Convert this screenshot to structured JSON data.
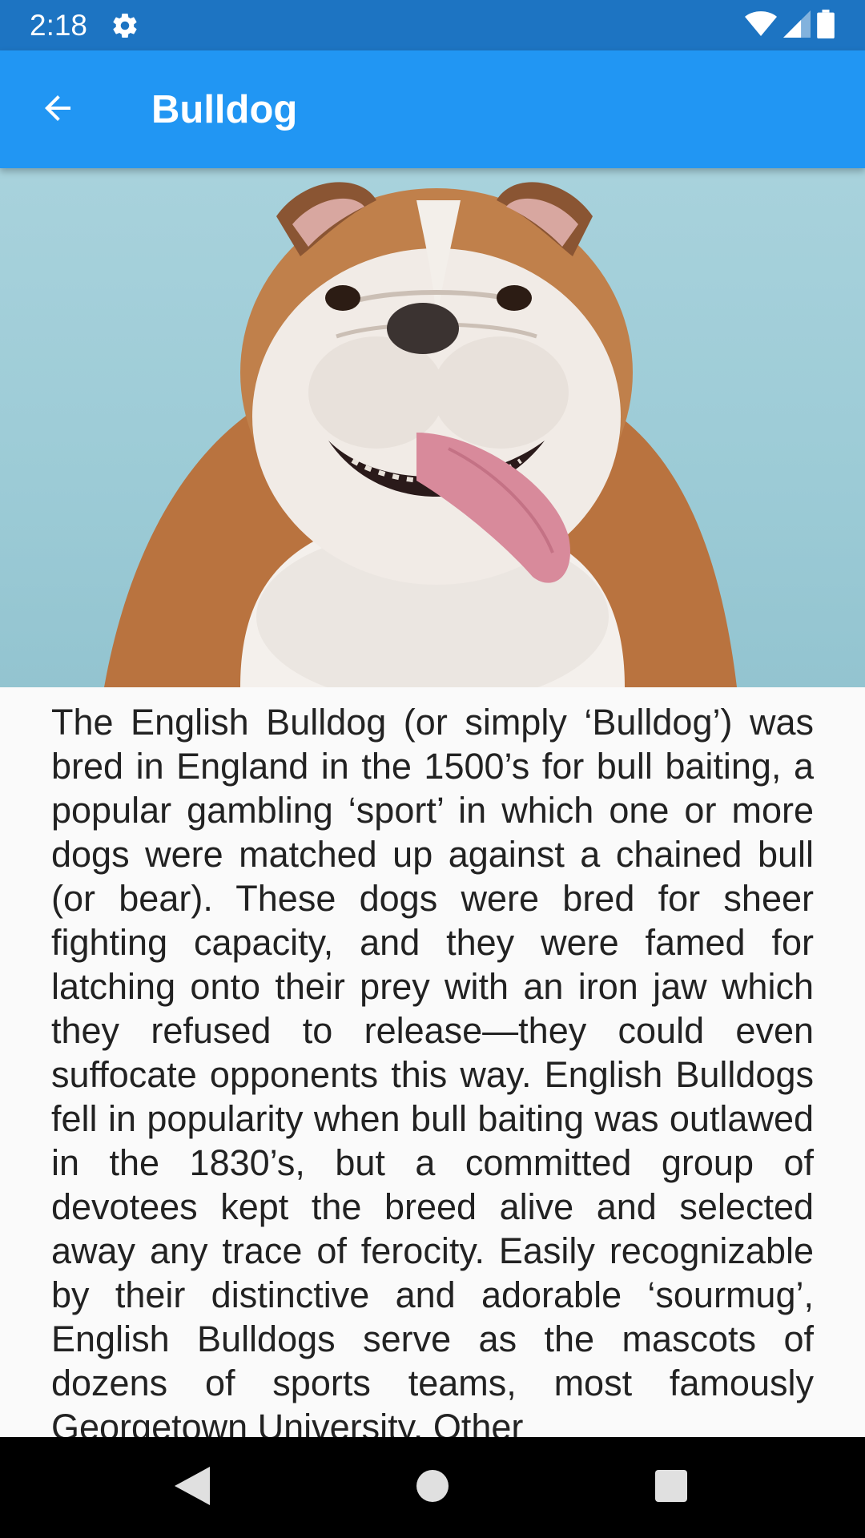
{
  "status_bar": {
    "time": "2:18",
    "icons": [
      "settings-gear-icon",
      "wifi-icon",
      "cellular-signal-icon",
      "battery-icon"
    ]
  },
  "app_bar": {
    "title": "Bulldog",
    "back_icon": "arrow-back-icon",
    "background_color": "#2196f3"
  },
  "hero_image": {
    "subject": "bulldog-photo"
  },
  "description": "The English Bulldog (or simply ‘Bulldog’) was bred in England in the 1500’s for bull baiting, a popular gambling ‘sport’ in which one or more dogs were matched up against a chained bull (or bear). These dogs were bred for sheer fighting capacity, and they were famed for latching onto their prey with an iron jaw which they refused to release—they could even suffocate opponents this way. English Bulldogs fell in popularity when bull baiting was outlawed in the 1830’s, but a committed group of devotees kept the breed alive and selected away any trace of ferocity. Easily recognizable by their distinctive and adorable ‘sourmug’, English Bulldogs serve as the mascots of dozens of sports teams, most famously Georgetown University. Other",
  "nav_bar": {
    "buttons": [
      "back-triangle-icon",
      "home-circle-icon",
      "recents-square-icon"
    ]
  }
}
